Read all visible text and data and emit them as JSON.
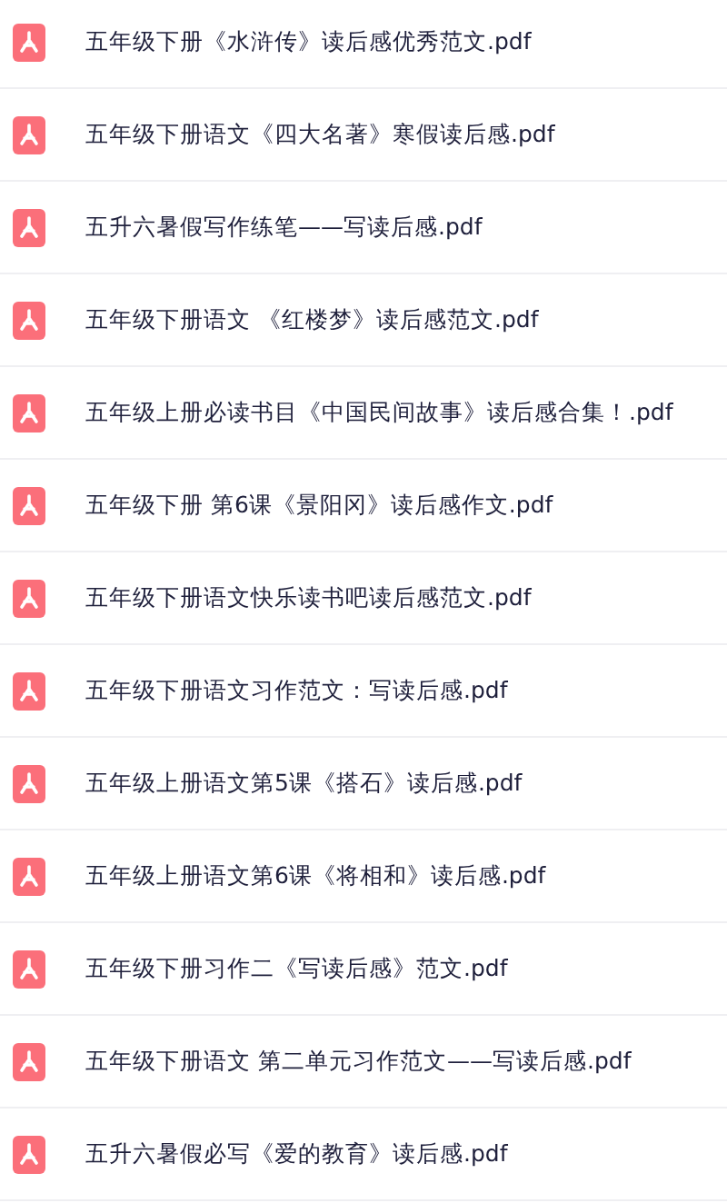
{
  "files": [
    {
      "name": "五年级下册《水浒传》读后感优秀范文.pdf"
    },
    {
      "name": "五年级下册语文《四大名著》寒假读后感.pdf"
    },
    {
      "name": "五升六暑假写作练笔——写读后感.pdf"
    },
    {
      "name": "五年级下册语文 《红楼梦》读后感范文.pdf"
    },
    {
      "name": "五年级上册必读书目《中国民间故事》读后感合集！.pdf"
    },
    {
      "name": "五年级下册 第6课《景阳冈》读后感作文.pdf"
    },
    {
      "name": "五年级下册语文快乐读书吧读后感范文.pdf"
    },
    {
      "name": "五年级下册语文习作范文：写读后感.pdf"
    },
    {
      "name": "五年级上册语文第5课《搭石》读后感.pdf"
    },
    {
      "name": "五年级上册语文第6课《将相和》读后感.pdf"
    },
    {
      "name": "五年级下册习作二《写读后感》范文.pdf"
    },
    {
      "name": "五年级下册语文 第二单元习作范文——写读后感.pdf"
    },
    {
      "name": "五升六暑假必写《爱的教育》读后感.pdf"
    }
  ]
}
